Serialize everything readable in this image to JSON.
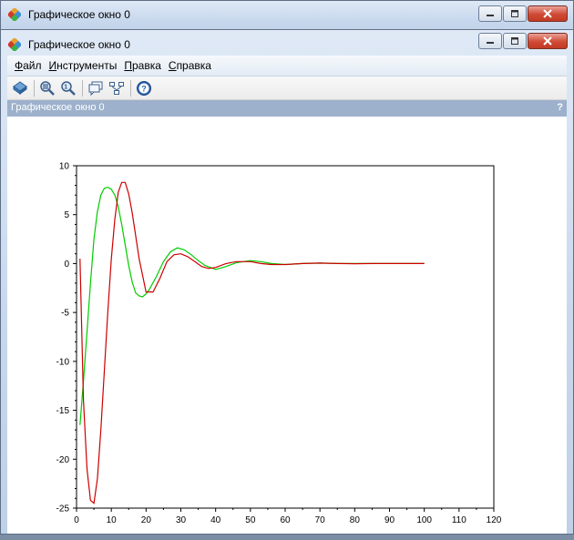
{
  "back_window": {
    "title": "Графическое окно 0"
  },
  "window": {
    "title": "Графическое окно 0"
  },
  "menu": {
    "file": {
      "first": "Ф",
      "rest": "айл"
    },
    "tools": {
      "first": "И",
      "rest": "нструменты"
    },
    "edit": {
      "first": "П",
      "rest": "равка"
    },
    "help": {
      "first": "С",
      "rest": "правка"
    }
  },
  "toolbar": {
    "icons": [
      "rotate-icon",
      "zoom-in-icon",
      "zoom-reset-icon",
      "datatip-icon",
      "datatip-style-icon",
      "help-icon"
    ]
  },
  "doc": {
    "title": "Графическое окно 0",
    "help": "?"
  },
  "colors": {
    "series_red": "#cc0000",
    "series_green": "#00cc00",
    "title_close": "#c9422d"
  },
  "chart_data": {
    "type": "line",
    "title": "",
    "xlabel": "",
    "ylabel": "",
    "xlim": [
      0,
      120
    ],
    "ylim": [
      -25,
      10
    ],
    "xticks": [
      "0",
      "10",
      "20",
      "30",
      "40",
      "50",
      "60",
      "70",
      "80",
      "90",
      "100",
      "110",
      "120"
    ],
    "yticks": [
      "10",
      "5",
      "0",
      "-5",
      "-10",
      "-15",
      "-20",
      "-25"
    ],
    "grid": false,
    "series": [
      {
        "color": "#cc0000",
        "x": [
          1,
          2,
          3,
          4,
          5,
          6,
          7,
          8,
          9,
          10,
          11,
          12,
          13,
          14,
          15,
          16,
          18,
          20,
          22,
          24,
          26,
          28,
          30,
          32,
          34,
          36,
          38,
          40,
          43,
          46,
          50,
          53,
          56,
          60,
          65,
          70,
          75,
          80,
          85,
          90,
          95,
          100
        ],
        "y": [
          0.5,
          -14,
          -21,
          -24.2,
          -24.5,
          -22,
          -17,
          -11,
          -5,
          0.5,
          4.5,
          7.3,
          8.3,
          8.3,
          7.1,
          5.2,
          0.5,
          -2.9,
          -2.9,
          -1.5,
          0.2,
          0.9,
          1.0,
          0.7,
          0.2,
          -0.3,
          -0.5,
          -0.4,
          0.0,
          0.2,
          0.2,
          0.0,
          -0.1,
          -0.1,
          0.0,
          0.05,
          0.0,
          -0.02,
          0.0,
          0.0,
          0.0,
          0.0
        ]
      },
      {
        "color": "#00cc00",
        "x": [
          1,
          2,
          3,
          4,
          5,
          6,
          7,
          8,
          9,
          10,
          11,
          12,
          13,
          14,
          15,
          16,
          17,
          18,
          19,
          20,
          21,
          23,
          25,
          27,
          29,
          31,
          33,
          35,
          37,
          40,
          43,
          46,
          50,
          53,
          56,
          60,
          65,
          70,
          75,
          80,
          85,
          90,
          95,
          100
        ],
        "y": [
          -16.5,
          -12,
          -7,
          -2,
          2.5,
          5.3,
          7.0,
          7.7,
          7.8,
          7.6,
          7.0,
          5.8,
          4.0,
          1.9,
          -0.2,
          -1.9,
          -3.0,
          -3.3,
          -3.4,
          -3.1,
          -2.6,
          -1.3,
          0.2,
          1.2,
          1.6,
          1.4,
          0.9,
          0.3,
          -0.2,
          -0.6,
          -0.3,
          0.1,
          0.3,
          0.2,
          0.0,
          -0.1,
          0.0,
          0.05,
          0.0,
          0.0,
          0.0,
          0.0,
          0.0,
          0.0
        ]
      }
    ]
  }
}
